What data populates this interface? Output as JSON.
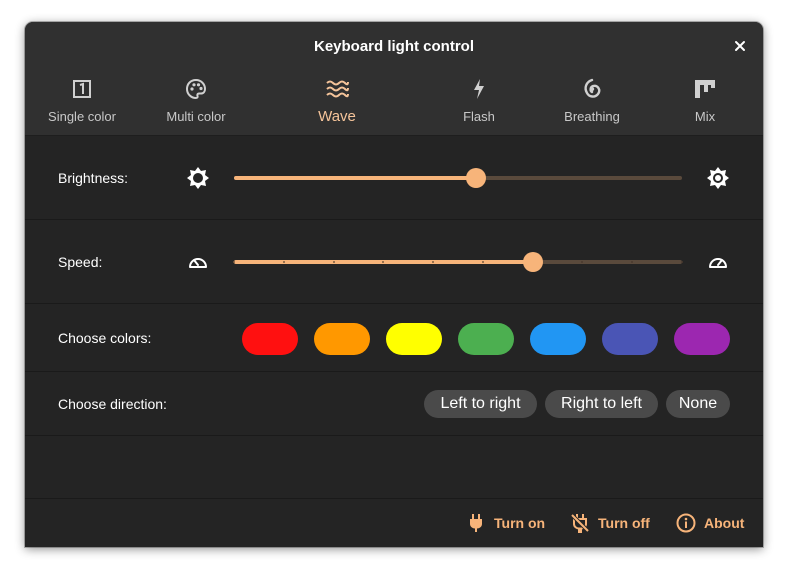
{
  "window": {
    "title": "Keyboard light control"
  },
  "tabs": [
    {
      "label": "Single color",
      "icon": "single-color-icon",
      "active": false
    },
    {
      "label": "Multi color",
      "icon": "palette-icon",
      "active": false
    },
    {
      "label": "Wave",
      "icon": "wave-icon",
      "active": true
    },
    {
      "label": "Flash",
      "icon": "flash-icon",
      "active": false
    },
    {
      "label": "Breathing",
      "icon": "breathing-icon",
      "active": false
    },
    {
      "label": "Mix",
      "icon": "mix-icon",
      "active": false
    }
  ],
  "brightness": {
    "label": "Brightness:",
    "value": 0.54
  },
  "speed": {
    "label": "Speed:",
    "value": 0.667,
    "steps": 9
  },
  "colors": {
    "label": "Choose colors:",
    "swatches": [
      "#ff1010",
      "#ff9800",
      "#ffff00",
      "#4caf50",
      "#2196f3",
      "#4a55b5",
      "#9c27b0"
    ]
  },
  "direction": {
    "label": "Choose direction:",
    "options": [
      "Left to right",
      "Right to left",
      "None"
    ]
  },
  "footer": {
    "turn_on": "Turn on",
    "turn_off": "Turn off",
    "about": "About"
  },
  "accent": "#f7b47a"
}
